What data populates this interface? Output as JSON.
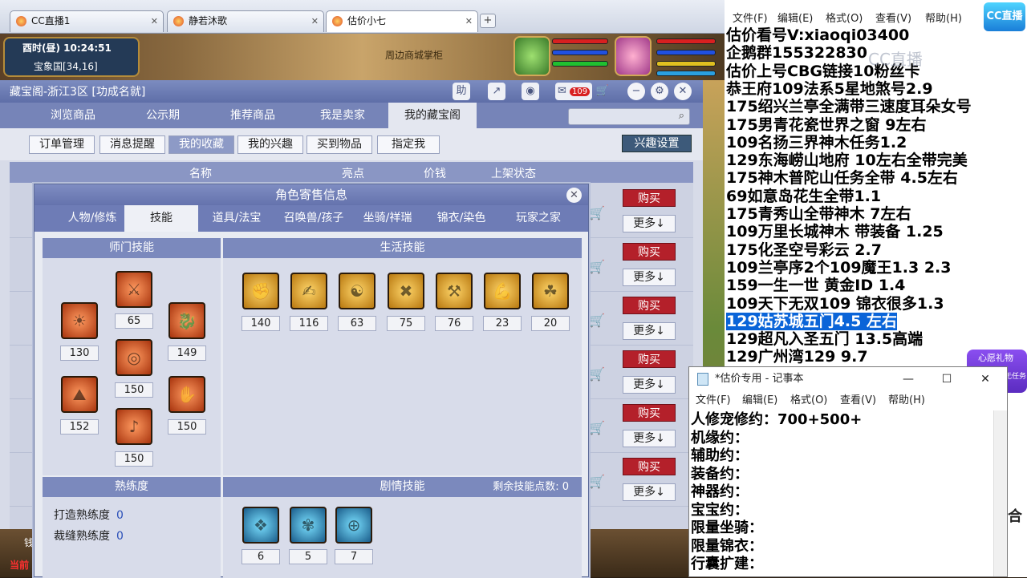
{
  "browser_tabs": [
    {
      "label": "CC直播1"
    },
    {
      "label": "静若沐歌"
    },
    {
      "label": "估价小七"
    }
  ],
  "game_hud": {
    "time": "酉时(昼)  10:24:51",
    "location": "宝象国[34,16]",
    "shop_sign": "周边商城掌柜",
    "bottom_left": "钱",
    "bottom_left2": "当前"
  },
  "app": {
    "title": "藏宝阁-浙江3区 [功成名就]",
    "help_label": "助",
    "badge_count": "109",
    "nav_tabs": [
      "浏览商品",
      "公示期",
      "推荐商品",
      "我是卖家",
      "我的藏宝阁"
    ],
    "sub_buttons": [
      "订单管理",
      "消息提醒",
      "我的收藏",
      "我的兴趣",
      "买到物品",
      "指定我"
    ],
    "interest_button": "兴趣设置",
    "list_headers": [
      "名称",
      "亮点",
      "价钱",
      "上架状态"
    ],
    "buy_label": "购买",
    "more_label": "更多↓"
  },
  "dialog": {
    "title": "角色寄售信息",
    "tabs": [
      "人物/修炼",
      "技能",
      "道具/法宝",
      "召唤兽/孩子",
      "坐骑/祥瑞",
      "锦衣/染色",
      "玩家之家"
    ],
    "sect_title": "师门技能",
    "life_title": "生活技能",
    "prof_title": "熟练度",
    "story_title": "剧情技能",
    "remaining_label": "剩余技能点数:",
    "remaining_value": "0",
    "sect_levels": [
      "65",
      "130",
      "149",
      "150",
      "152",
      "150",
      "150"
    ],
    "life_levels": [
      "140",
      "116",
      "63",
      "75",
      "76",
      "23",
      "20"
    ],
    "prof_rows": [
      {
        "label": "打造熟练度",
        "value": "0"
      },
      {
        "label": "裁缝熟练度",
        "value": "0"
      }
    ],
    "story_levels": [
      "6",
      "5",
      "7"
    ]
  },
  "textpanel": {
    "menu": [
      "文件(F)",
      "编辑(E)",
      "格式(O)",
      "查看(V)",
      "帮助(H)"
    ],
    "lines": [
      "估价看号V:xiaoqi03400",
      "企鹅群155322830",
      "估价上号CBG链接10粉丝卡",
      "恭王府109法系5星地煞号2.9",
      "175绍兴兰亭全满带三速度耳朵女号",
      "175男青花瓷世界之窗  9左右",
      "109名扬三界神木任务1.2",
      "129东海崂山地府 10左右全带完美",
      "175神木普陀山任务全带 4.5左右",
      "69如意岛花生全带1.1",
      "175青秀山全带神木  7左右",
      "109万里长城神木 带装备  1.25",
      "175化圣空号彩云 2.7",
      "109兰亭序2个109魔王1.3 2.3",
      "159一生一世 黄金ID 1.4",
      "109天下无双109  锦衣很多1.3",
      "129姑苏城五门4.5 左右",
      "129超凡入圣五门  13.5高端",
      "129广州湾129 9.7"
    ],
    "selected_index": 16,
    "cc_logo": "CC直播",
    "watermark": "CC直播",
    "gift_label": "心愿礼物",
    "gift_sub": "暂无任务",
    "edge_char": "合"
  },
  "notepad": {
    "title": "*估价专用 - 记事本",
    "menu": [
      "文件(F)",
      "编辑(E)",
      "格式(O)",
      "查看(V)",
      "帮助(H)"
    ],
    "lines": [
      "人修宠修约：700+500+",
      "机缘约：",
      "辅助约：",
      "装备约：",
      "神器约：",
      "宝宝约：",
      "限量坐骑：",
      "限量锦衣：",
      "行囊扩建："
    ]
  },
  "colors": {
    "buy_red": "#b4202a",
    "nav_blue": "#7684b8",
    "selection_blue": "#0a64d8"
  }
}
